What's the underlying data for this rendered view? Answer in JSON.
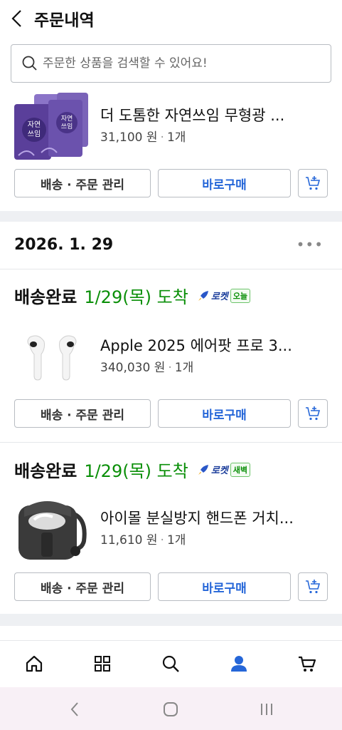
{
  "header": {
    "title": "주문내역"
  },
  "search": {
    "placeholder": "주문한 상품을 검색할 수 있어요!"
  },
  "buttons": {
    "manage": "배송 · 주문 관리",
    "buy_again": "바로구매"
  },
  "order_top": {
    "item": {
      "name": "더 도톰한 자연쓰임 무형광 ...",
      "price": "31,100 원",
      "qty": "1개",
      "thumb_text": [
        "자연",
        "쓰임"
      ]
    }
  },
  "order_group": {
    "date": "2026. 1. 29",
    "deliveries": [
      {
        "status": "배송완료",
        "arrival": "1/29(목) 도착",
        "rocket_word": "로켓",
        "rocket_tag": "오늘",
        "item": {
          "name": "Apple 2025 에어팟 프로 3...",
          "price": "340,030 원",
          "qty": "1개"
        }
      },
      {
        "status": "배송완료",
        "arrival": "1/29(목) 도착",
        "rocket_word": "로켓",
        "rocket_tag": "새벽",
        "item": {
          "name": "아이몰 분실방지 핸드폰 거치...",
          "price": "11,610 원",
          "qty": "1개"
        }
      }
    ]
  },
  "colors": {
    "accent_blue": "#2566d8",
    "arrival_green": "#0a8f08",
    "rocket_navy": "#1d3f9c"
  },
  "bottom_nav": [
    "home-icon",
    "category-icon",
    "search-icon",
    "my-icon",
    "cart-icon"
  ]
}
